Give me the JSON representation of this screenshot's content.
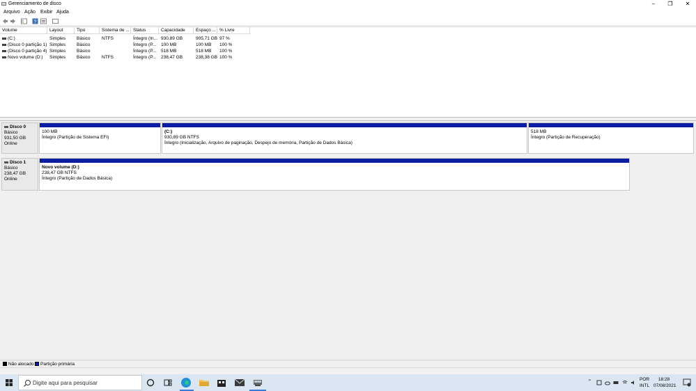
{
  "window": {
    "title": "Gerenciamento de disco",
    "controls": {
      "minimize": "–",
      "maximize": "❐",
      "close": "✕"
    }
  },
  "menu": [
    "Arquivo",
    "Ação",
    "Exibir",
    "Ajuda"
  ],
  "volume_table": {
    "headers": [
      "Volume",
      "Layout",
      "Tipo",
      "Sistema de ...",
      "Status",
      "Capacidade",
      "Espaço ...",
      "% Livre"
    ],
    "rows": [
      [
        "(C:)",
        "Simples",
        "Básico",
        "NTFS",
        "Íntegro (In...",
        "930,89 GB",
        "905,71 GB",
        "97 %"
      ],
      [
        "(Disco 0 partição 1)",
        "Simples",
        "Básico",
        "",
        "Íntegro (P...",
        "100 MB",
        "100 MB",
        "100 %"
      ],
      [
        "(Disco 0 partição 4)",
        "Simples",
        "Básico",
        "",
        "Íntegro (P...",
        "518 MB",
        "518 MB",
        "100 %"
      ],
      [
        "Novo volume (D:)",
        "Simples",
        "Básico",
        "NTFS",
        "Íntegro (P...",
        "238,47 GB",
        "238,38 GB",
        "100 %"
      ]
    ]
  },
  "disks": [
    {
      "name": "Disco 0",
      "type": "Básico",
      "size": "931,50 GB",
      "status": "Online",
      "partitions": [
        {
          "title": "",
          "size": "100 MB",
          "status": "Íntegro (Partição de Sistema EFI)"
        },
        {
          "title": "(C:)",
          "size": "930,89 GB NTFS",
          "status": "Íntegro (Inicialização, Arquivo de paginação, Despejo de memória, Partição de Dados Básica)"
        },
        {
          "title": "",
          "size": "518 MB",
          "status": "Íntegro (Partição de Recuperação)"
        }
      ]
    },
    {
      "name": "Disco 1",
      "type": "Básico",
      "size": "238,47 GB",
      "status": "Online",
      "partitions": [
        {
          "title": "Novo volume (D:)",
          "size": "238,47 GB NTFS",
          "status": "Íntegro (Partição de Dados Básica)"
        }
      ]
    }
  ],
  "legend": [
    {
      "label": "Não alocado",
      "color": "#000000"
    },
    {
      "label": "Partição primária",
      "color": "#0b1da2"
    }
  ],
  "taskbar": {
    "search_placeholder": "Digite aqui para pesquisar",
    "language": "POR",
    "layout": "INTL",
    "time": "18:28",
    "date": "07/08/2021"
  },
  "colors": {
    "partition_bar": "#0b1da2",
    "taskbar": "#dbe6f3"
  }
}
